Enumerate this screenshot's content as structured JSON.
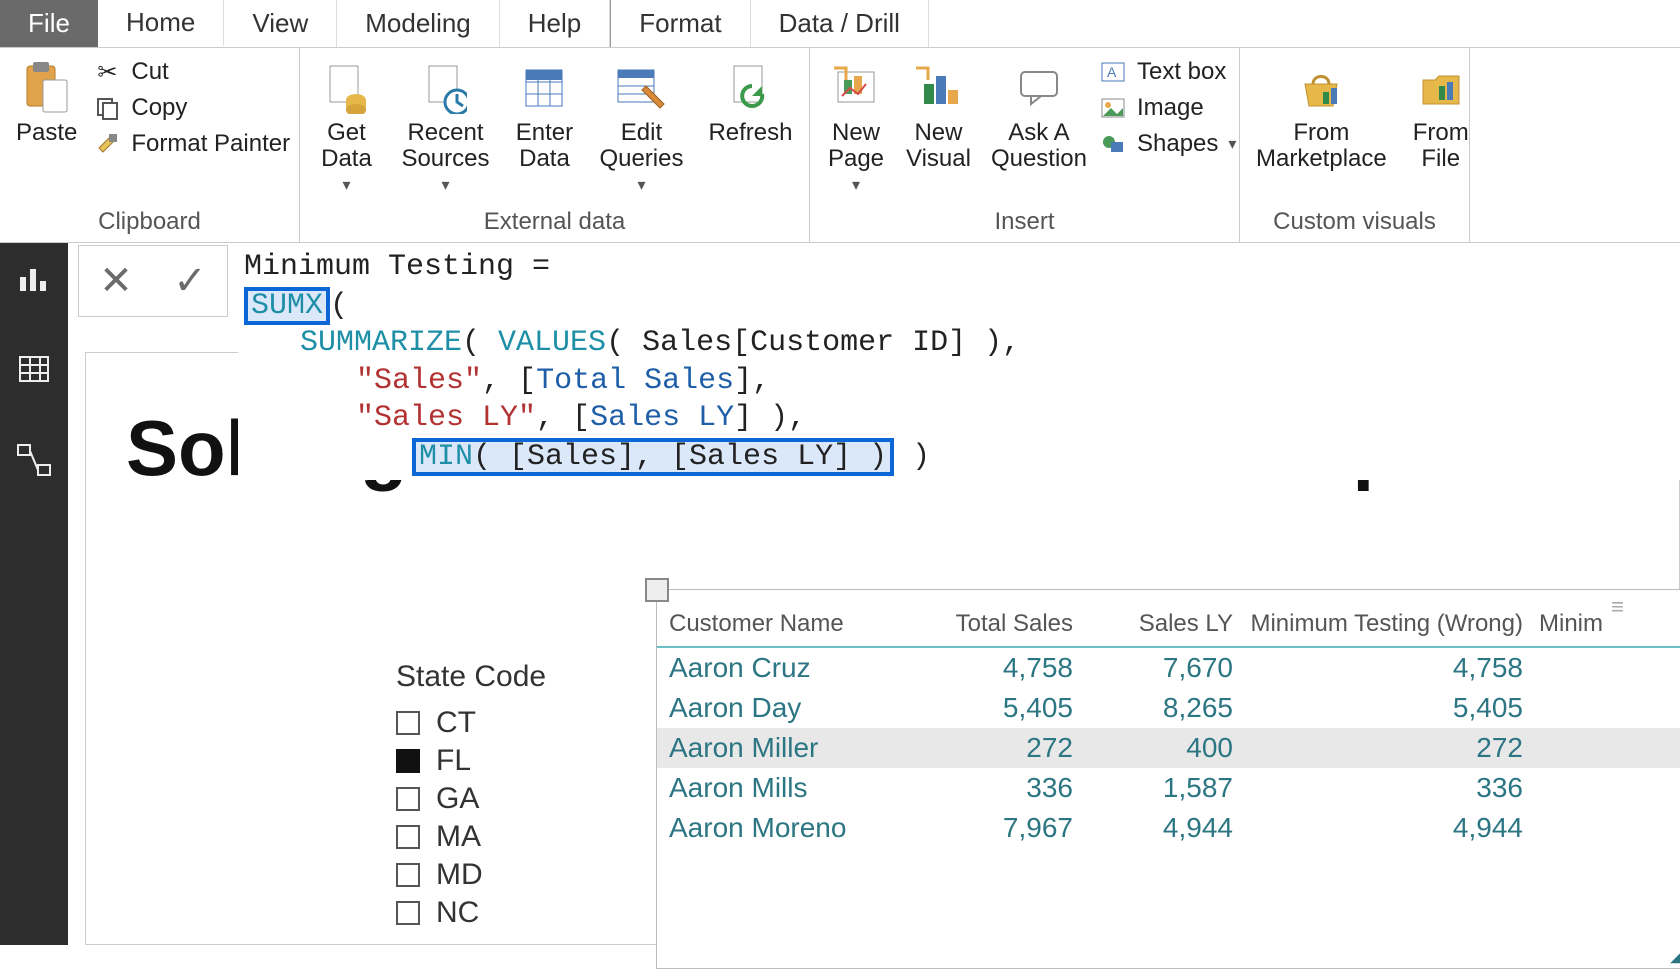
{
  "tabs": {
    "file": "File",
    "home": "Home",
    "view": "View",
    "modeling": "Modeling",
    "help": "Help",
    "format": "Format",
    "datadrill": "Data / Drill"
  },
  "ribbon": {
    "clipboard": {
      "paste": "Paste",
      "cut": "Cut",
      "copy": "Copy",
      "format_painter": "Format Painter",
      "group": "Clipboard"
    },
    "external": {
      "get_data": "Get\nData",
      "recent_sources": "Recent\nSources",
      "enter_data": "Enter\nData",
      "edit_queries": "Edit\nQueries",
      "refresh": "Refresh",
      "group": "External data"
    },
    "insert": {
      "new_page": "New\nPage",
      "new_visual": "New\nVisual",
      "ask_a_question": "Ask A\nQuestion",
      "text_box": "Text box",
      "image": "Image",
      "shapes": "Shapes",
      "group": "Insert"
    },
    "custom": {
      "from_marketplace": "From\nMarketplace",
      "from_file": "From\nFile",
      "group": "Custom visuals"
    }
  },
  "formula": {
    "def": "Minimum Testing = ",
    "sumx": "SUMX",
    "paren1": "(",
    "summarize": "SUMMARIZE",
    "values": "VALUES",
    "values_arg": "( Sales[Customer ID] ),",
    "sales_lit": "\"Sales\"",
    "comma1": ", ",
    "total_sales": "[Total Sales]",
    "tail1": ",",
    "salesly_lit": "\"Sales LY\"",
    "salesly_mem": "[Sales LY]",
    "tail2": " ),",
    "min": "MIN",
    "min_args": "( [Sales], [Sales LY] )",
    "close": " )",
    "open_bracket": "[",
    "close_bracket_comma": "],",
    "open_paren_sp": "( "
  },
  "canvas": {
    "title": "Solving totals issues in with complex DAX"
  },
  "slicer": {
    "title": "State Code",
    "items": [
      "CT",
      "FL",
      "GA",
      "MA",
      "MD",
      "NC"
    ],
    "selected_index": 1
  },
  "table": {
    "headers": [
      "Customer Name",
      "Total Sales",
      "Sales LY",
      "Minimum Testing (Wrong)",
      "Minim"
    ],
    "rows": [
      {
        "name": "Aaron Cruz",
        "total": "4,758",
        "ly": "7,670",
        "minw": "4,758"
      },
      {
        "name": "Aaron Day",
        "total": "5,405",
        "ly": "8,265",
        "minw": "5,405"
      },
      {
        "name": "Aaron Miller",
        "total": "272",
        "ly": "400",
        "minw": "272"
      },
      {
        "name": "Aaron Mills",
        "total": "336",
        "ly": "1,587",
        "minw": "336"
      },
      {
        "name": "Aaron Moreno",
        "total": "7,967",
        "ly": "4,944",
        "minw": "4,944"
      }
    ],
    "selected_row": 2
  }
}
